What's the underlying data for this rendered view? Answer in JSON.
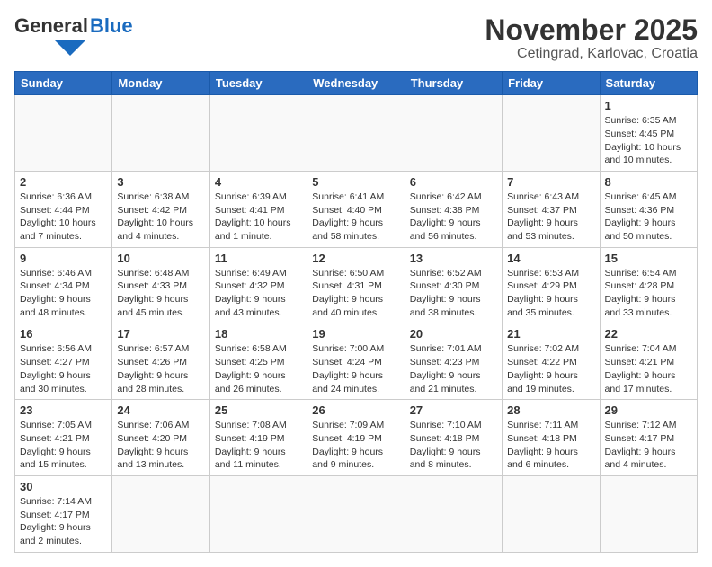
{
  "header": {
    "logo_general": "General",
    "logo_blue": "Blue",
    "title": "November 2025",
    "subtitle": "Cetingrad, Karlovac, Croatia"
  },
  "weekdays": [
    "Sunday",
    "Monday",
    "Tuesday",
    "Wednesday",
    "Thursday",
    "Friday",
    "Saturday"
  ],
  "days": [
    {
      "num": "",
      "info": ""
    },
    {
      "num": "",
      "info": ""
    },
    {
      "num": "",
      "info": ""
    },
    {
      "num": "",
      "info": ""
    },
    {
      "num": "",
      "info": ""
    },
    {
      "num": "",
      "info": ""
    },
    {
      "num": "1",
      "info": "Sunrise: 6:35 AM\nSunset: 4:45 PM\nDaylight: 10 hours\nand 10 minutes."
    },
    {
      "num": "2",
      "info": "Sunrise: 6:36 AM\nSunset: 4:44 PM\nDaylight: 10 hours\nand 7 minutes."
    },
    {
      "num": "3",
      "info": "Sunrise: 6:38 AM\nSunset: 4:42 PM\nDaylight: 10 hours\nand 4 minutes."
    },
    {
      "num": "4",
      "info": "Sunrise: 6:39 AM\nSunset: 4:41 PM\nDaylight: 10 hours\nand 1 minute."
    },
    {
      "num": "5",
      "info": "Sunrise: 6:41 AM\nSunset: 4:40 PM\nDaylight: 9 hours\nand 58 minutes."
    },
    {
      "num": "6",
      "info": "Sunrise: 6:42 AM\nSunset: 4:38 PM\nDaylight: 9 hours\nand 56 minutes."
    },
    {
      "num": "7",
      "info": "Sunrise: 6:43 AM\nSunset: 4:37 PM\nDaylight: 9 hours\nand 53 minutes."
    },
    {
      "num": "8",
      "info": "Sunrise: 6:45 AM\nSunset: 4:36 PM\nDaylight: 9 hours\nand 50 minutes."
    },
    {
      "num": "9",
      "info": "Sunrise: 6:46 AM\nSunset: 4:34 PM\nDaylight: 9 hours\nand 48 minutes."
    },
    {
      "num": "10",
      "info": "Sunrise: 6:48 AM\nSunset: 4:33 PM\nDaylight: 9 hours\nand 45 minutes."
    },
    {
      "num": "11",
      "info": "Sunrise: 6:49 AM\nSunset: 4:32 PM\nDaylight: 9 hours\nand 43 minutes."
    },
    {
      "num": "12",
      "info": "Sunrise: 6:50 AM\nSunset: 4:31 PM\nDaylight: 9 hours\nand 40 minutes."
    },
    {
      "num": "13",
      "info": "Sunrise: 6:52 AM\nSunset: 4:30 PM\nDaylight: 9 hours\nand 38 minutes."
    },
    {
      "num": "14",
      "info": "Sunrise: 6:53 AM\nSunset: 4:29 PM\nDaylight: 9 hours\nand 35 minutes."
    },
    {
      "num": "15",
      "info": "Sunrise: 6:54 AM\nSunset: 4:28 PM\nDaylight: 9 hours\nand 33 minutes."
    },
    {
      "num": "16",
      "info": "Sunrise: 6:56 AM\nSunset: 4:27 PM\nDaylight: 9 hours\nand 30 minutes."
    },
    {
      "num": "17",
      "info": "Sunrise: 6:57 AM\nSunset: 4:26 PM\nDaylight: 9 hours\nand 28 minutes."
    },
    {
      "num": "18",
      "info": "Sunrise: 6:58 AM\nSunset: 4:25 PM\nDaylight: 9 hours\nand 26 minutes."
    },
    {
      "num": "19",
      "info": "Sunrise: 7:00 AM\nSunset: 4:24 PM\nDaylight: 9 hours\nand 24 minutes."
    },
    {
      "num": "20",
      "info": "Sunrise: 7:01 AM\nSunset: 4:23 PM\nDaylight: 9 hours\nand 21 minutes."
    },
    {
      "num": "21",
      "info": "Sunrise: 7:02 AM\nSunset: 4:22 PM\nDaylight: 9 hours\nand 19 minutes."
    },
    {
      "num": "22",
      "info": "Sunrise: 7:04 AM\nSunset: 4:21 PM\nDaylight: 9 hours\nand 17 minutes."
    },
    {
      "num": "23",
      "info": "Sunrise: 7:05 AM\nSunset: 4:21 PM\nDaylight: 9 hours\nand 15 minutes."
    },
    {
      "num": "24",
      "info": "Sunrise: 7:06 AM\nSunset: 4:20 PM\nDaylight: 9 hours\nand 13 minutes."
    },
    {
      "num": "25",
      "info": "Sunrise: 7:08 AM\nSunset: 4:19 PM\nDaylight: 9 hours\nand 11 minutes."
    },
    {
      "num": "26",
      "info": "Sunrise: 7:09 AM\nSunset: 4:19 PM\nDaylight: 9 hours\nand 9 minutes."
    },
    {
      "num": "27",
      "info": "Sunrise: 7:10 AM\nSunset: 4:18 PM\nDaylight: 9 hours\nand 8 minutes."
    },
    {
      "num": "28",
      "info": "Sunrise: 7:11 AM\nSunset: 4:18 PM\nDaylight: 9 hours\nand 6 minutes."
    },
    {
      "num": "29",
      "info": "Sunrise: 7:12 AM\nSunset: 4:17 PM\nDaylight: 9 hours\nand 4 minutes."
    },
    {
      "num": "30",
      "info": "Sunrise: 7:14 AM\nSunset: 4:17 PM\nDaylight: 9 hours\nand 2 minutes."
    },
    {
      "num": "",
      "info": ""
    },
    {
      "num": "",
      "info": ""
    },
    {
      "num": "",
      "info": ""
    },
    {
      "num": "",
      "info": ""
    },
    {
      "num": "",
      "info": ""
    },
    {
      "num": "",
      "info": ""
    }
  ]
}
